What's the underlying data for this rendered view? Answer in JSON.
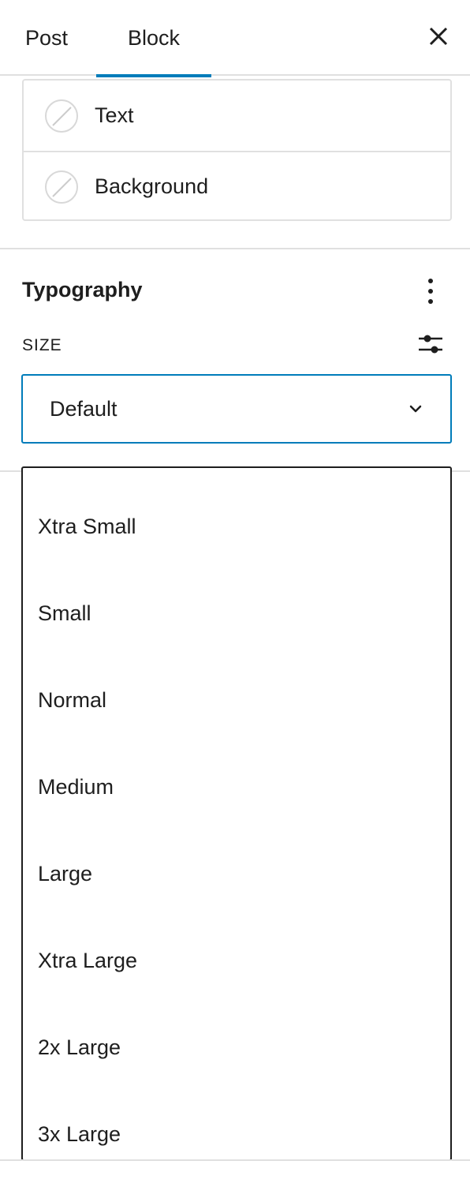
{
  "tabs": {
    "post": "Post",
    "block": "Block",
    "active": "Block",
    "accent_color": "#007cba"
  },
  "color": {
    "items": [
      {
        "label": "Text",
        "value": "none"
      },
      {
        "label": "Background",
        "value": "none"
      }
    ]
  },
  "typography": {
    "title": "Typography",
    "size_label": "SIZE",
    "select": {
      "value": "Default"
    },
    "options": [
      "Xtra Small",
      "Small",
      "Normal",
      "Medium",
      "Large",
      "Xtra Large",
      "2x Large",
      "3x Large"
    ]
  }
}
